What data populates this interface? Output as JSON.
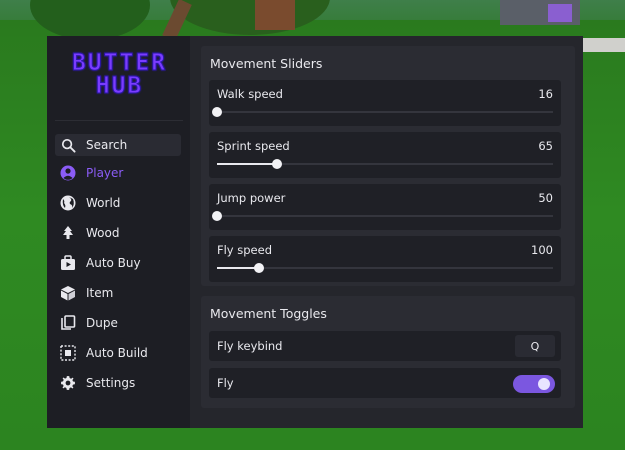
{
  "app": {
    "logo_line1": "BUTTER",
    "logo_line2": "HUB"
  },
  "theme": {
    "accent": "#8b5cf6",
    "panel": "#1c1c22",
    "row": "#1f2026"
  },
  "sidebar": {
    "search_label": "Search",
    "items": [
      {
        "label": "Player",
        "icon": "user-circle-icon",
        "active": true
      },
      {
        "label": "World",
        "icon": "globe-icon"
      },
      {
        "label": "Wood",
        "icon": "tree-icon"
      },
      {
        "label": "Auto Buy",
        "icon": "store-icon"
      },
      {
        "label": "Item",
        "icon": "cube-icon"
      },
      {
        "label": "Dupe",
        "icon": "copy-icon"
      },
      {
        "label": "Auto Build",
        "icon": "select-box-icon"
      },
      {
        "label": "Settings",
        "icon": "gear-icon"
      }
    ]
  },
  "movement_sliders": {
    "title": "Movement Sliders",
    "items": [
      {
        "label": "Walk speed",
        "value": "16",
        "fraction": 0.0
      },
      {
        "label": "Sprint speed",
        "value": "65",
        "fraction": 0.18
      },
      {
        "label": "Jump power",
        "value": "50",
        "fraction": 0.0
      },
      {
        "label": "Fly speed",
        "value": "100",
        "fraction": 0.125
      }
    ]
  },
  "movement_toggles": {
    "title": "Movement Toggles",
    "fly_keybind_label": "Fly keybind",
    "fly_keybind_value": "Q",
    "fly_label": "Fly",
    "fly_enabled": true
  }
}
